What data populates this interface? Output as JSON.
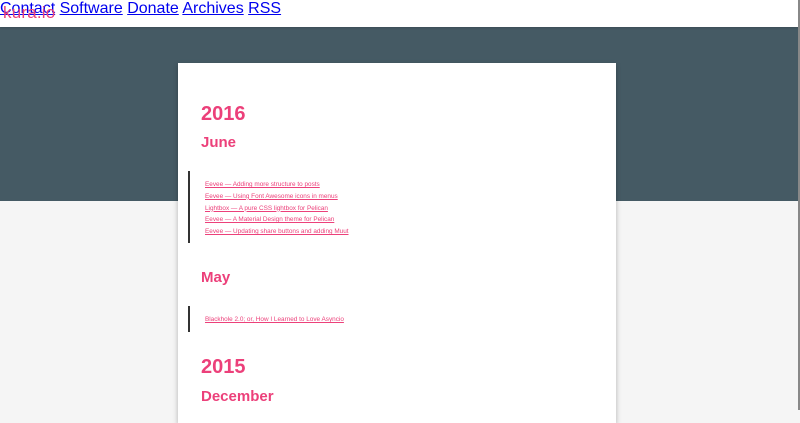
{
  "brand": "kura.io",
  "nav": [
    {
      "label": "Contact"
    },
    {
      "label": "Software"
    },
    {
      "label": "Donate"
    },
    {
      "label": "Archives"
    },
    {
      "label": "RSS"
    }
  ],
  "archive": [
    {
      "year": "2016",
      "months": [
        {
          "name": "June",
          "posts": [
            "Eevee — Adding more structure to posts",
            "Eevee — Using Font Awesome icons in menus",
            "Lightbox — A pure CSS lightbox for Pelican",
            "Eevee — A Material Design theme for Pelican",
            "Eevee — Updating share buttons and adding Muut"
          ]
        },
        {
          "name": "May",
          "posts": [
            "Blackhole 2.0; or, How I Learned to Love Asyncio"
          ]
        }
      ]
    },
    {
      "year": "2015",
      "months": [
        {
          "name": "December",
          "posts": []
        }
      ]
    }
  ],
  "colors": {
    "accent": "#ec407a",
    "hero": "#455a64",
    "background": "#f5f5f5"
  }
}
